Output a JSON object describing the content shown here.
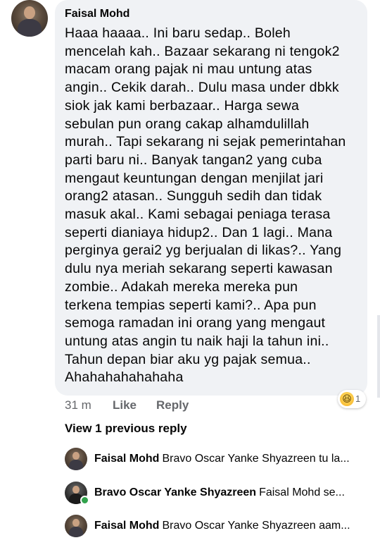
{
  "comment": {
    "author": "Faisal Mohd",
    "text": "Haaa haaaa.. Ini baru sedap.. Boleh\nmencelah kah.. Bazaar sekarang ni tengok2\nmacam orang pajak ni mau untung atas\nangin.. Cekik darah.. Dulu masa under dbkk\nsiok jak kami berbazaar.. Harga sewa\nsebulan pun orang cakap alhamdulillah\nmurah.. Tapi sekarang ni sejak pemerintahan\nparti baru ni.. Banyak tangan2 yang cuba\nmengaut keuntungan dengan menjilat jari\norang2 atasan.. Sungguh sedih dan tidak\nmasuk akal.. Kami sebagai peniaga terasa\nseperti dianiaya hidup2.. Dan 1 lagi.. Mana\nperginya gerai2 yg berjualan di likas?.. Yang\ndulu nya meriah sekarang seperti kawasan\nzombie.. Adakah mereka mereka pun\nterkena tempias seperti kami?.. Apa pun\nsemoga ramadan ini orang yang mengaut\nuntung atas angin tu naik haji la tahun ini..\nTahun depan biar aku yg pajak semua..\nAhahahahahahaha",
    "time": "31 m",
    "like_label": "Like",
    "reply_label": "Reply",
    "reaction": {
      "icon": "haha-emoji-icon",
      "glyph": "😆",
      "count": "1"
    }
  },
  "view_previous_label": "View 1 previous reply",
  "replies": [
    {
      "name": "Faisal Mohd",
      "snippet": "Bravo Oscar Yanke Shyazreen tu la..."
    },
    {
      "name": "Bravo Oscar Yanke Shyazreen",
      "snippet": "Faisal Mohd se..."
    },
    {
      "name": "Faisal Mohd",
      "snippet": "Bravo Oscar Yanke Shyazreen aam..."
    }
  ],
  "colors": {
    "bubble": "#f0f2f5",
    "secondary_text": "#65676b",
    "online": "#31a24c"
  }
}
